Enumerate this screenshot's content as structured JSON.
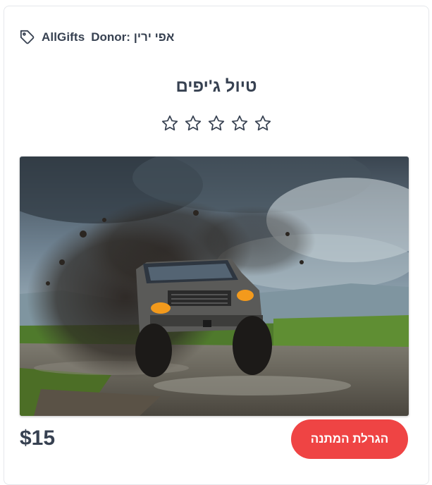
{
  "donor": {
    "brand": "AllGifts",
    "label": "Donor: אפי ירין",
    "icon": "tag-icon"
  },
  "gift": {
    "title": "טיול ג'יפים",
    "rating": 0,
    "max_rating": 5,
    "price": "$15",
    "image_icon": "offroad-jeep-photo"
  },
  "actions": {
    "raffle_label": "הגרלת המתנה"
  },
  "colors": {
    "accent": "#ef4444",
    "text": "#374151",
    "star_outline": "#374151"
  }
}
